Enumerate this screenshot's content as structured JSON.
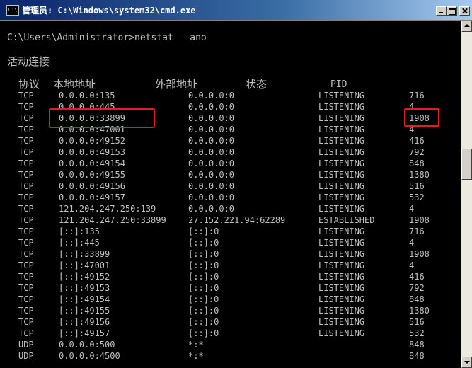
{
  "window": {
    "title": "管理员: C:\\Windows\\system32\\cmd.exe",
    "icon_text": "C:\\"
  },
  "console": {
    "command": "C:\\Users\\Administrator>netstat  -ano",
    "section_title": "活动连接",
    "headers": [
      "协议",
      "本地地址",
      "外部地址",
      "状态",
      "PID"
    ],
    "rows": [
      [
        "TCP",
        "0.0.0.0:135",
        "0.0.0.0:0",
        "LISTENING",
        "716"
      ],
      [
        "TCP",
        "0.0.0.0:445",
        "0.0.0.0:0",
        "LISTENING",
        "4"
      ],
      [
        "TCP",
        "0.0.0.0:33899",
        "0.0.0.0:0",
        "LISTENING",
        "1908"
      ],
      [
        "TCP",
        "0.0.0.0:47001",
        "0.0.0.0:0",
        "LISTENING",
        "4"
      ],
      [
        "TCP",
        "0.0.0.0:49152",
        "0.0.0.0:0",
        "LISTENING",
        "416"
      ],
      [
        "TCP",
        "0.0.0.0:49153",
        "0.0.0.0:0",
        "LISTENING",
        "792"
      ],
      [
        "TCP",
        "0.0.0.0:49154",
        "0.0.0.0:0",
        "LISTENING",
        "848"
      ],
      [
        "TCP",
        "0.0.0.0:49155",
        "0.0.0.0:0",
        "LISTENING",
        "1380"
      ],
      [
        "TCP",
        "0.0.0.0:49156",
        "0.0.0.0:0",
        "LISTENING",
        "516"
      ],
      [
        "TCP",
        "0.0.0.0:49157",
        "0.0.0.0:0",
        "LISTENING",
        "532"
      ],
      [
        "TCP",
        "121.204.247.250:139",
        "0.0.0.0:0",
        "LISTENING",
        "4"
      ],
      [
        "TCP",
        "121.204.247.250:33899",
        "27.152.221.94:62289",
        "ESTABLISHED",
        "1908"
      ],
      [
        "TCP",
        "[::]:135",
        "[::]:0",
        "LISTENING",
        "716"
      ],
      [
        "TCP",
        "[::]:445",
        "[::]:0",
        "LISTENING",
        "4"
      ],
      [
        "TCP",
        "[::]:33899",
        "[::]:0",
        "LISTENING",
        "1908"
      ],
      [
        "TCP",
        "[::]:47001",
        "[::]:0",
        "LISTENING",
        "4"
      ],
      [
        "TCP",
        "[::]:49152",
        "[::]:0",
        "LISTENING",
        "416"
      ],
      [
        "TCP",
        "[::]:49153",
        "[::]:0",
        "LISTENING",
        "792"
      ],
      [
        "TCP",
        "[::]:49154",
        "[::]:0",
        "LISTENING",
        "848"
      ],
      [
        "TCP",
        "[::]:49155",
        "[::]:0",
        "LISTENING",
        "1380"
      ],
      [
        "TCP",
        "[::]:49156",
        "[::]:0",
        "LISTENING",
        "516"
      ],
      [
        "TCP",
        "[::]:49157",
        "[::]:0",
        "LISTENING",
        "532"
      ],
      [
        "UDP",
        "0.0.0.0:500",
        "*:*",
        "",
        "848"
      ],
      [
        "UDP",
        "0.0.0.0:4500",
        "*:*",
        "",
        "848"
      ]
    ]
  },
  "colors": {
    "console_bg": "#000000",
    "console_text": "#c0c0c0",
    "highlight": "#e0201e",
    "titlebar_start": "#0a246a",
    "titlebar_end": "#a6caf0"
  },
  "icons": {
    "window_icon": "cmd-icon",
    "minimize": "minimize-icon",
    "maximize": "maximize-icon",
    "close": "close-icon"
  }
}
